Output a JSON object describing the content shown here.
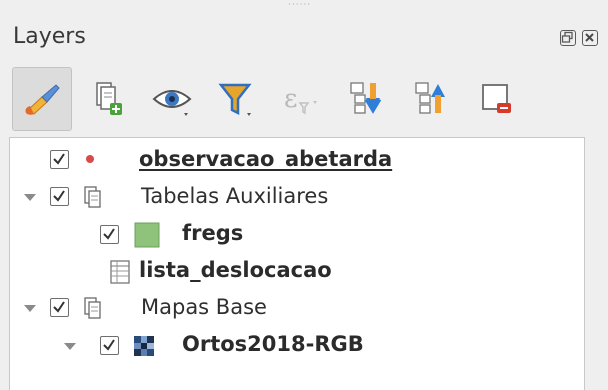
{
  "panel": {
    "title": "Layers"
  },
  "toolbar": {
    "buttons": [
      {
        "icon": "style-manager-icon"
      },
      {
        "icon": "add-group-icon"
      },
      {
        "icon": "eye-visibility-icon"
      },
      {
        "icon": "filter-legend-icon"
      },
      {
        "icon": "filter-expression-icon"
      },
      {
        "icon": "expand-all-icon"
      },
      {
        "icon": "collapse-all-icon"
      },
      {
        "icon": "remove-layer-icon"
      }
    ]
  },
  "layers": [
    {
      "label": "observacao_abetarda",
      "type": "point-layer",
      "checked": true,
      "bold": true,
      "underline": true,
      "color": "#d84a4a"
    },
    {
      "label": "Tabelas Auxiliares",
      "type": "group",
      "checked": true,
      "expanded": true
    },
    {
      "label": "fregs",
      "type": "polygon-layer",
      "checked": true,
      "bold": true,
      "color": "#8fc27a"
    },
    {
      "label": "lista_deslocacao",
      "type": "table-layer",
      "bold": true
    },
    {
      "label": "Mapas Base",
      "type": "group",
      "checked": true,
      "expanded": true
    },
    {
      "label": "Ortos2018-RGB",
      "type": "raster-layer",
      "checked": true,
      "bold": true,
      "expanded": true
    }
  ],
  "colors": {
    "accent_orange": "#f0a030",
    "accent_blue": "#2f7fd8",
    "filter_yellow": "#e7a52a"
  }
}
